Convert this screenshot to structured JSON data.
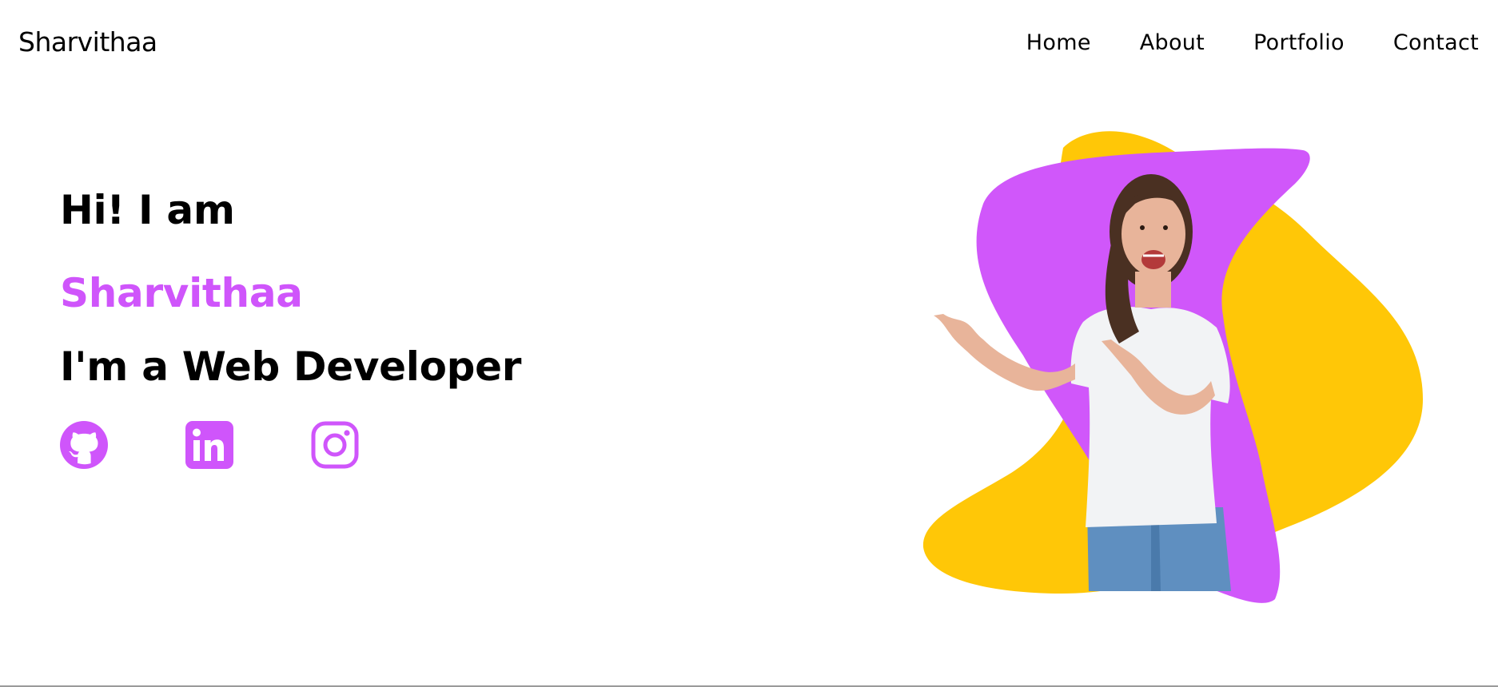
{
  "header": {
    "brand": "Sharvithaa",
    "nav": [
      {
        "label": "Home"
      },
      {
        "label": "About"
      },
      {
        "label": "Portfolio"
      },
      {
        "label": "Contact"
      }
    ]
  },
  "hero": {
    "greeting": "Hi! I am",
    "name": "Sharvithaa",
    "role": "I'm a Web Developer"
  },
  "socials": [
    {
      "icon": "github-icon"
    },
    {
      "icon": "linkedin-icon"
    },
    {
      "icon": "instagram-icon"
    }
  ],
  "colors": {
    "accent": "#cf55fb",
    "yellow": "#ffc707",
    "text": "#000000",
    "background": "#ffffff"
  }
}
